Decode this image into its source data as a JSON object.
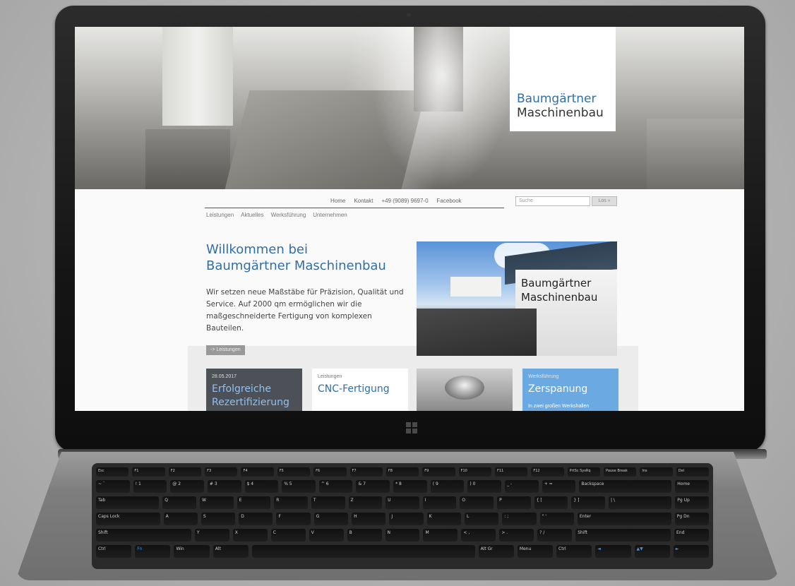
{
  "hero": {
    "logo_line1": "Baumgärtner",
    "logo_line2": "Maschinenbau"
  },
  "topnav": {
    "items": [
      "Home",
      "Kontakt",
      "+49 (9089) 9697-0",
      "Facebook"
    ],
    "search_placeholder": "Suche",
    "search_button": "Los »"
  },
  "mainnav": {
    "items": [
      "Leistungen",
      "Aktuelles",
      "Werksführung",
      "Unternehmen"
    ]
  },
  "intro": {
    "heading_line1": "Willkommen bei",
    "heading_line2": "Baumgärtner Maschinenbau",
    "text": "Wir setzen neue Maßstäbe für Präzision, Qualität und Service. Auf 2000 qm ermöglichen wir die maßgeschneiderte Fertigung von komplexen Bauteilen.",
    "more_button": "-> Leistungen"
  },
  "building_sign": {
    "line1": "Baumgärtner",
    "line2": "Maschinenbau"
  },
  "tiles": [
    {
      "meta": "28.05.2017",
      "title": "Erfolgreiche Rezertifizierung"
    },
    {
      "meta": "Leistungen",
      "title": "CNC-Fertigung"
    },
    {
      "meta": "",
      "title": ""
    },
    {
      "meta": "Werksführung",
      "title": "Zerspanung",
      "sub": "In zwei großen Werkshallen"
    }
  ],
  "keyboard": {
    "row1": [
      "Esc",
      "F1",
      "F2",
      "F3",
      "F4",
      "F5",
      "F6",
      "F7",
      "F8",
      "F9",
      "F10",
      "F11",
      "F12",
      "PrtSc SysRq",
      "Pause Break",
      "Ins",
      "Del"
    ],
    "row2": [
      "~ `",
      "! 1",
      "@ 2",
      "# 3",
      "$ 4",
      "% 5",
      "^ 6",
      "& 7",
      "* 8",
      "( 9",
      ") 0",
      "_ -",
      "+ =",
      "Backspace",
      "Home"
    ],
    "row3": [
      "Tab",
      "Q",
      "W",
      "E",
      "R",
      "T",
      "Z",
      "U",
      "I",
      "O",
      "P",
      "{ [",
      "} ]",
      "| \\",
      "Pg Up"
    ],
    "row4": [
      "Caps Lock",
      "A",
      "S",
      "D",
      "F",
      "G",
      "H",
      "J",
      "K",
      "L",
      ": ;",
      "\" '",
      "Enter",
      "Pg Dn"
    ],
    "row5": [
      "Shift",
      "Y",
      "X",
      "C",
      "V",
      "B",
      "N",
      "M",
      "< ,",
      "> .",
      "? /",
      "Shift",
      "End"
    ],
    "row6": [
      "Ctrl",
      "Fn",
      "Win",
      "Alt",
      "",
      "Alt Gr",
      "Menu",
      "Ctrl",
      "◄",
      "▲▼",
      "►"
    ]
  }
}
